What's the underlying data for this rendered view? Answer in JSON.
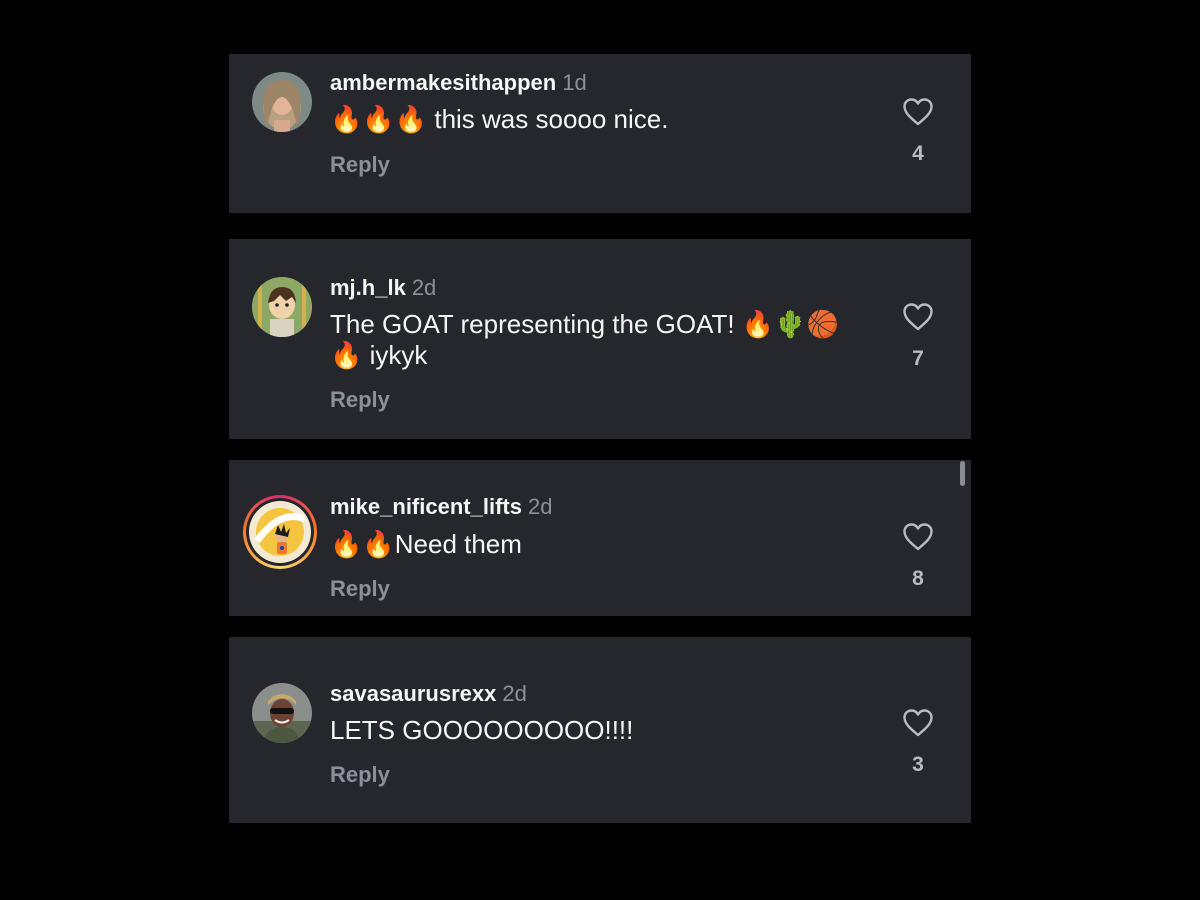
{
  "comments": [
    {
      "username": "ambermakesithappen",
      "time": "1d",
      "text": "🔥🔥🔥 this was soooo nice.",
      "reply_label": "Reply",
      "likes": "4",
      "avatar_icon": "profile-photo-woman",
      "story_ring": false
    },
    {
      "username": "mj.h_lk",
      "time": "2d",
      "text": "The GOAT representing the GOAT! 🔥🌵🏀🔥 iykyk",
      "reply_label": "Reply",
      "likes": "7",
      "avatar_icon": "cartoon-avatar",
      "story_ring": false
    },
    {
      "username": "mike_nificent_lifts",
      "time": "2d",
      "text": "🔥🔥Need them",
      "reply_label": "Reply",
      "likes": "8",
      "avatar_icon": "anime-character-avatar",
      "story_ring": true
    },
    {
      "username": "savasaurusrexx",
      "time": "2d",
      "text": "LETS GOOOOOOOOO!!!!",
      "reply_label": "Reply",
      "likes": "3",
      "avatar_icon": "profile-photo-man-sunglasses",
      "story_ring": false
    }
  ],
  "colors": {
    "background": "#000000",
    "card": "#25272c",
    "secondary_text": "#8e9099",
    "story_ring_start": "#d62976",
    "story_ring_end": "#feda75"
  }
}
